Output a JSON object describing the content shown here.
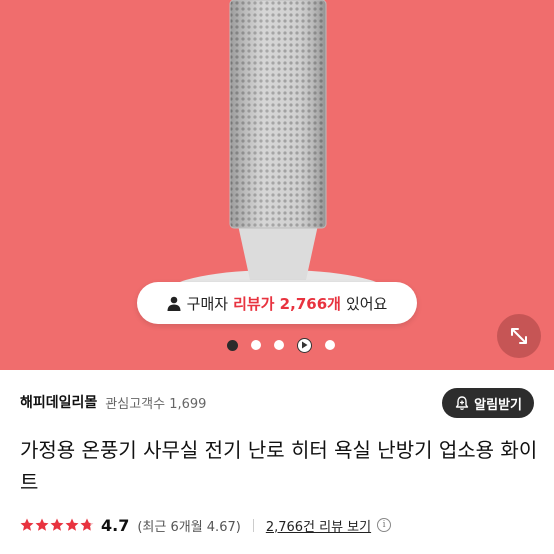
{
  "hero": {
    "background_color": "#f06d6d",
    "review_banner": {
      "prefix": "구매자",
      "highlight": "리뷰가 2,766개",
      "suffix": "있어요",
      "highlight_color": "#e8333f"
    },
    "carousel": {
      "dots": [
        "active",
        "default",
        "default",
        "video",
        "default"
      ]
    },
    "expand_icon": "expand-arrows-icon"
  },
  "seller": {
    "name": "해피데일리몰",
    "followers_label": "관심고객수",
    "followers_count": "1,699",
    "alarm_button": "알림받기",
    "alarm_icon": "bell-plus-icon"
  },
  "product": {
    "title": "가정용 온풍기 사무실 전기 난로 히터 욕실 난방기 업소용 화이트"
  },
  "rating": {
    "score": "4.7",
    "stars": 4.7,
    "recent_summary": "(최근 6개월 4.67)",
    "review_link": "2,766건 리뷰 보기",
    "star_color": "#e8333f",
    "info_icon": "i"
  }
}
